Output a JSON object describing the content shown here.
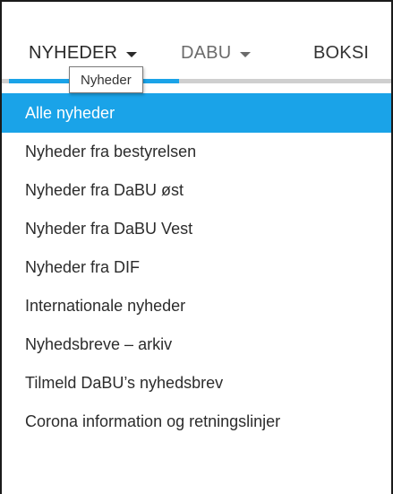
{
  "nav": {
    "items": [
      {
        "label": "NYHEDER",
        "has_caret": true,
        "state": "active"
      },
      {
        "label": "DABU",
        "has_caret": true,
        "state": "normal"
      },
      {
        "label": "BOKSI",
        "has_caret": false,
        "state": "normal"
      }
    ],
    "tooltip": "Nyheder"
  },
  "dropdown": {
    "items": [
      {
        "label": "Alle nyheder",
        "active": true
      },
      {
        "label": "Nyheder fra bestyrelsen",
        "active": false
      },
      {
        "label": "Nyheder fra DaBU øst",
        "active": false
      },
      {
        "label": "Nyheder fra DaBU Vest",
        "active": false
      },
      {
        "label": "Nyheder fra DIF",
        "active": false
      },
      {
        "label": "Internationale nyheder",
        "active": false
      },
      {
        "label": "Nyhedsbreve – arkiv",
        "active": false
      },
      {
        "label": "Tilmeld DaBU’s nyhedsbrev",
        "active": false
      },
      {
        "label": "Corona information og retningslinjer",
        "active": false
      }
    ]
  },
  "colors": {
    "accent": "#1aa3e8",
    "text": "#2c2c2c",
    "divider": "#cfcfcf"
  }
}
